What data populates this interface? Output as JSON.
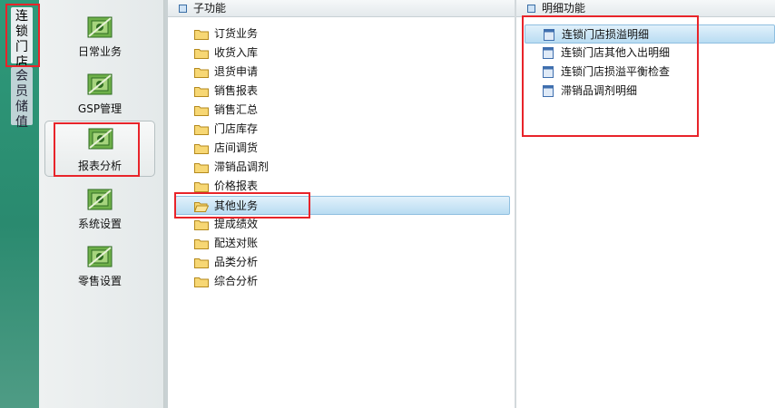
{
  "vertical_tabs": [
    {
      "label": "连锁门店"
    },
    {
      "label": "会员储值"
    }
  ],
  "modules": [
    {
      "label": "日常业务",
      "icon": "money-icon"
    },
    {
      "label": "GSP管理",
      "icon": "money-icon"
    },
    {
      "label": "报表分析",
      "icon": "money-icon"
    },
    {
      "label": "系统设置",
      "icon": "money-icon"
    },
    {
      "label": "零售设置",
      "icon": "money-icon"
    }
  ],
  "sub_panel": {
    "title": "子功能",
    "items": [
      {
        "label": "订货业务"
      },
      {
        "label": "收货入库"
      },
      {
        "label": "退货申请"
      },
      {
        "label": "销售报表"
      },
      {
        "label": "销售汇总"
      },
      {
        "label": "门店库存"
      },
      {
        "label": "店间调货"
      },
      {
        "label": "滞销品调剂"
      },
      {
        "label": "价格报表"
      },
      {
        "label": "其他业务"
      },
      {
        "label": "提成绩效"
      },
      {
        "label": "配送对账"
      },
      {
        "label": "品类分析"
      },
      {
        "label": "综合分析"
      }
    ]
  },
  "detail_panel": {
    "title": "明细功能",
    "items": [
      {
        "label": "连锁门店损溢明细"
      },
      {
        "label": "连锁门店其他入出明细"
      },
      {
        "label": "连锁门店损溢平衡检查"
      },
      {
        "label": "滞销品调剂明细"
      }
    ]
  },
  "colors": {
    "accent": "#2a8a6f",
    "highlight": "#e8242a",
    "selection": "#b9dcf2"
  }
}
